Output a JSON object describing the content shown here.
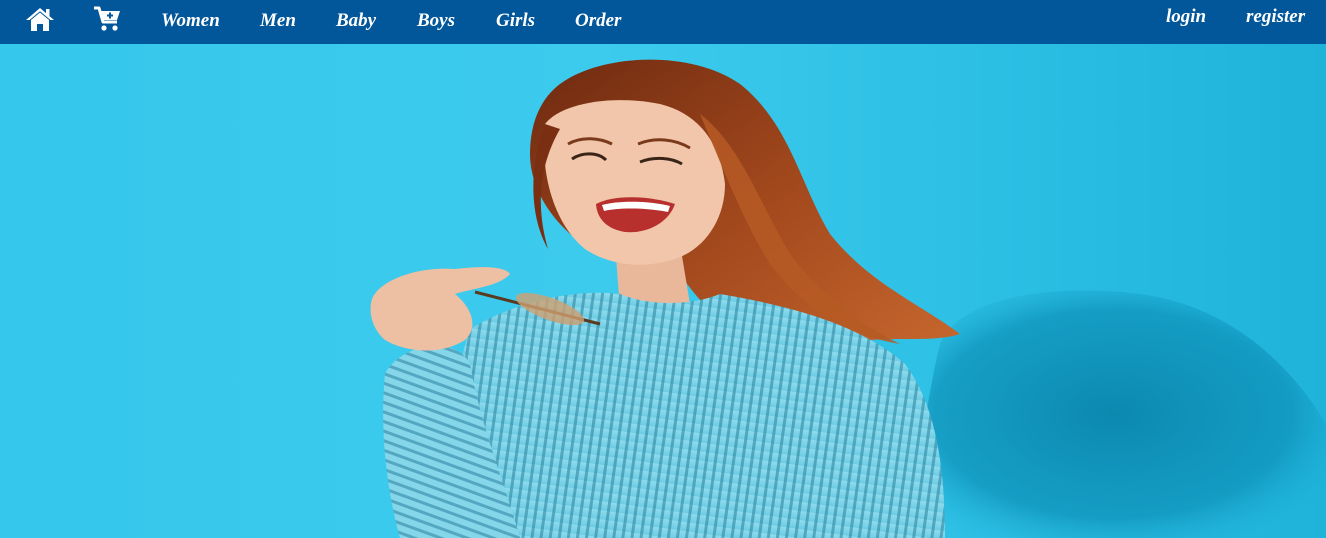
{
  "nav": {
    "home_icon": "home-icon",
    "cart_icon": "cart-icon",
    "links": [
      "Women",
      "Men",
      "Baby",
      "Boys",
      "Girls",
      "Order"
    ],
    "login": "login",
    "register": "register"
  },
  "colors": {
    "navbar": "#02569a",
    "nav_text": "#ffffff",
    "hero_background": "#35c7ec",
    "sweater": "#7fd6ea",
    "hair": "#8a3a17"
  }
}
